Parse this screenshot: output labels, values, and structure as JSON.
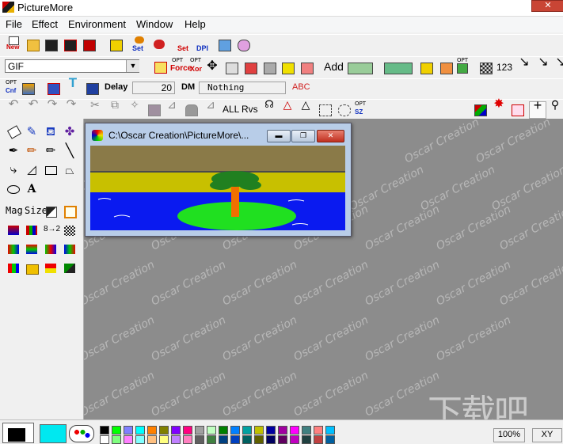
{
  "window": {
    "title": "PictureMore",
    "close_glyph": "✕"
  },
  "menu": [
    "File",
    "Effect",
    "Environment",
    "Window",
    "Help"
  ],
  "toolbar1": {
    "new_label": "New",
    "set_label": "Set",
    "set2_label": "Set",
    "dpi_label": "DPI"
  },
  "toolbar2": {
    "format_value": "GIF",
    "opt_label": "OPT",
    "force_label": "Force",
    "xor_label": "Xor",
    "add_label": "Add",
    "num_label": "123"
  },
  "toolbar3": {
    "cnf_label": "Cnf",
    "delay_label": "Delay",
    "delay_value": "20",
    "dm_label": "DM",
    "dm_value": "Nothing",
    "abc_label": "ABC"
  },
  "toolbar4": {
    "all_label": "ALL",
    "rvs_label": "Rvs",
    "sz_label": "SZ"
  },
  "palette": {
    "mag_label": "Mag",
    "size_label": "Size",
    "ratio_label": "8→2",
    "text_glyph": "A"
  },
  "child_window": {
    "title": "C:\\Oscar Creation\\PictureMore\\..."
  },
  "workspace": {
    "watermark_text": "Oscar Creation",
    "logo_text": "下载吧"
  },
  "colors": {
    "accent": "#c94535",
    "workspace": "#8c8c8c",
    "swatches_row1": [
      "#000000",
      "#00ff00",
      "#8080ff",
      "#00ffff",
      "#ff8000",
      "#808000",
      "#8000ff",
      "#ff0080",
      "#a0a0a0",
      "#c0ffc0",
      "#008000",
      "#0080ff",
      "#00a0a0",
      "#c0c000",
      "#0000a0",
      "#a000a0",
      "#ff00ff",
      "#408080",
      "#ff8080",
      "#00c0ff"
    ],
    "swatches_row2": [
      "#ffffff",
      "#80ff80",
      "#ff80ff",
      "#80ffff",
      "#ffc080",
      "#ffff80",
      "#c080ff",
      "#ff80c0",
      "#606060",
      "#408040",
      "#004080",
      "#0040c0",
      "#006060",
      "#606000",
      "#000060",
      "#600060",
      "#c000c0",
      "#204040",
      "#c04040",
      "#0060a0"
    ]
  },
  "status": {
    "zoom": "100%",
    "xy_label": "XY"
  }
}
